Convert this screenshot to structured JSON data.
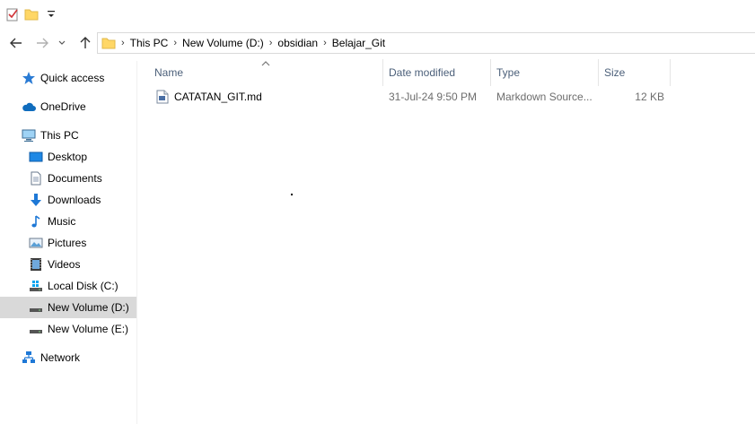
{
  "quick_access_toolbar": {
    "icons": [
      "properties-icon",
      "new-folder-icon",
      "customize-dropdown-icon"
    ]
  },
  "address_bar": {
    "crumbs": [
      "This PC",
      "New Volume (D:)",
      "obsidian",
      "Belajar_Git"
    ],
    "separator": "›"
  },
  "nav_pane": {
    "items": [
      {
        "label": "Quick access",
        "icon": "star-icon"
      },
      {
        "label": "OneDrive",
        "icon": "cloud-icon"
      },
      {
        "label": "This PC",
        "icon": "computer-icon"
      },
      {
        "label": "Desktop",
        "icon": "desktop-icon"
      },
      {
        "label": "Documents",
        "icon": "documents-icon"
      },
      {
        "label": "Downloads",
        "icon": "downloads-icon"
      },
      {
        "label": "Music",
        "icon": "music-icon"
      },
      {
        "label": "Pictures",
        "icon": "pictures-icon"
      },
      {
        "label": "Videos",
        "icon": "videos-icon"
      },
      {
        "label": "Local Disk (C:)",
        "icon": "drive-icon"
      },
      {
        "label": "New Volume (D:)",
        "icon": "drive-icon",
        "selected": true
      },
      {
        "label": "New Volume (E:)",
        "icon": "drive-icon"
      },
      {
        "label": "Network",
        "icon": "network-icon"
      }
    ]
  },
  "file_list": {
    "columns": [
      "Name",
      "Date modified",
      "Type",
      "Size"
    ],
    "rows": [
      {
        "name": "CATATAN_GIT.md",
        "date": "31-Jul-24 9:50 PM",
        "type": "Markdown Source...",
        "size": "12 KB"
      }
    ]
  },
  "colors": {
    "header_text": "#4c607a",
    "selected_bg": "#d9d9d9",
    "detail_text": "#6d6d6d",
    "folder_yellow": "#ffd766"
  }
}
